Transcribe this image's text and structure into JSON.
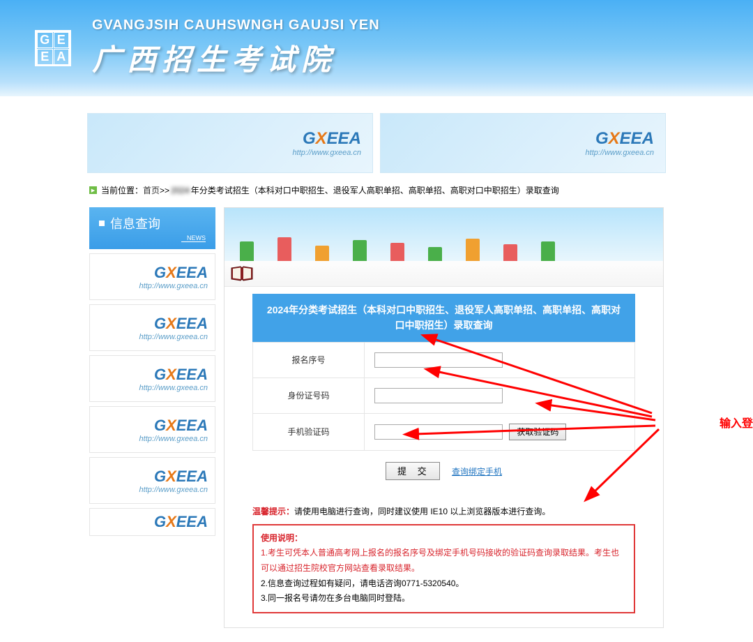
{
  "header": {
    "subtitle": "GVANGJSIH CAUHSWNGH GAUJSI YEN",
    "title": "广西招生考试院"
  },
  "ad": {
    "logo_prefix": "G",
    "logo_x": "X",
    "logo_suffix": "EEA",
    "url": "http://www.gxeea.cn"
  },
  "breadcrumb": {
    "label": "当前位置：",
    "home": "首页",
    "sep": ">>",
    "blurred": "2024",
    "page": "年分类考试招生（本科对口中职招生、退役军人高职单招、高职单招、高职对口中职招生）录取查询"
  },
  "sidebar": {
    "title": "信息查询",
    "news": "NEWS"
  },
  "form": {
    "title": "2024年分类考试招生（本科对口中职招生、退役军人高职单招、高职单招、高职对口中职招生）录取查询",
    "fields": {
      "regnum": "报名序号",
      "idcard": "身份证号码",
      "code": "手机验证码"
    },
    "get_code_btn": "获取验证码",
    "submit": "提 交",
    "bind_link": "查询绑定手机"
  },
  "tip": {
    "label": "温馨提示：",
    "text": "请使用电脑进行查询，同时建议使用 IE10 以上浏览器版本进行查询。"
  },
  "instructions": {
    "title": "使用说明：",
    "l1": "1.考生可凭本人普通高考网上报名的报名序号及绑定手机号码接收的验证码查询录取结果。考生也可以通过招生院校官方网站查看录取结果。",
    "l2": "2.信息查询过程如有疑问，请电话咨询0771-5320540。",
    "l3": "3.同一报名号请勿在多台电脑同时登陆。"
  },
  "annotation": {
    "text": "输入登录"
  }
}
